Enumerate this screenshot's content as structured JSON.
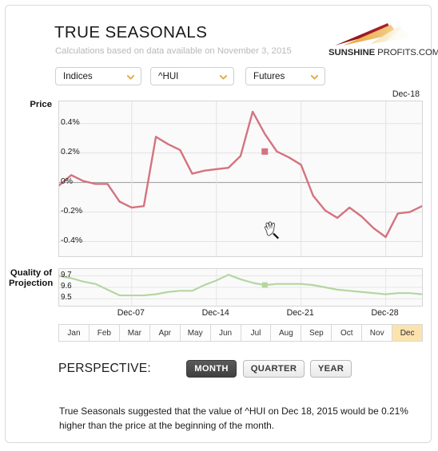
{
  "header": {
    "title": "TRUE SEASONALS",
    "subtitle": "Calculations based on data available on November 3, 2015",
    "logo_bold": "SUNSHINE ",
    "logo_light": "PROFITS.COM"
  },
  "selectors": [
    {
      "name": "indices",
      "value": "Indices"
    },
    {
      "name": "symbol",
      "value": "^HUI"
    },
    {
      "name": "market",
      "value": "Futures"
    }
  ],
  "price_chart": {
    "axis_title": "Price",
    "corner_label": "Dec-18",
    "y_ticks": [
      "0.4%",
      "0.2%",
      "0%",
      "-0.2%",
      "-0.4%"
    ]
  },
  "quality_chart": {
    "axis_title_line1": "Quality of",
    "axis_title_line2": "Projection",
    "y_ticks": [
      "9.7",
      "9.6",
      "9.5"
    ]
  },
  "x_axis": {
    "ticks": [
      "Dec-07",
      "Dec-14",
      "Dec-21",
      "Dec-28"
    ]
  },
  "months": {
    "items": [
      "Jan",
      "Feb",
      "Mar",
      "Apr",
      "May",
      "Jun",
      "Jul",
      "Aug",
      "Sep",
      "Oct",
      "Nov",
      "Dec"
    ],
    "selected": "Dec"
  },
  "perspective": {
    "label": "PERSPECTIVE:",
    "options": [
      "MONTH",
      "QUARTER",
      "YEAR"
    ],
    "selected": "MONTH"
  },
  "description": "True Seasonals suggested that the value of ^HUI on Dec 18, 2015 would be 0.21% higher than the price at the beginning of the month.",
  "colors": {
    "price_line": "#d4737f",
    "quality_line": "#b5d6a0",
    "month_active": "#fce3ae",
    "persp_active": "#4a4a4a",
    "panel_border": "#dadada",
    "plot_bg": "#fafafa"
  },
  "chart_data": [
    {
      "type": "line",
      "name": "price",
      "title": "Price",
      "ylabel": "Price",
      "xlabel": "",
      "ylim": [
        -0.5,
        0.55
      ],
      "yticks": [
        0.4,
        0.2,
        0.0,
        -0.2,
        -0.4
      ],
      "ytick_labels": [
        "0.4%",
        "0.2%",
        "0%",
        "-0.2%",
        "-0.4%"
      ],
      "xlim": [
        1,
        31
      ],
      "xticks": [
        7,
        14,
        21,
        28
      ],
      "xtick_labels": [
        "Dec-07",
        "Dec-14",
        "Dec-21",
        "Dec-28"
      ],
      "grid": true,
      "x": [
        1,
        2,
        3,
        4,
        5,
        6,
        7,
        8,
        9,
        10,
        11,
        12,
        13,
        14,
        15,
        16,
        17,
        18,
        19,
        20,
        21,
        22,
        23,
        24,
        25,
        26,
        27,
        28,
        29,
        30,
        31
      ],
      "values": [
        -0.02,
        0.05,
        0.01,
        -0.01,
        -0.01,
        -0.13,
        -0.17,
        -0.16,
        0.31,
        0.26,
        0.22,
        0.06,
        0.08,
        0.09,
        0.1,
        0.18,
        0.48,
        0.33,
        0.21,
        0.17,
        0.12,
        -0.09,
        -0.19,
        -0.24,
        -0.17,
        -0.23,
        -0.31,
        -0.37,
        -0.21,
        -0.2,
        -0.16
      ],
      "highlight_point": {
        "x": 18,
        "y": 0.21,
        "label": "Dec-18"
      }
    },
    {
      "type": "line",
      "name": "quality_of_projection",
      "title": "Quality of Projection",
      "ylabel": "Quality of Projection",
      "xlabel": "",
      "ylim": [
        9.44,
        9.76
      ],
      "yticks": [
        9.7,
        9.6,
        9.5
      ],
      "ytick_labels": [
        "9.7",
        "9.6",
        "9.5"
      ],
      "xlim": [
        1,
        31
      ],
      "xticks": [
        7,
        14,
        21,
        28
      ],
      "xtick_labels": [
        "Dec-07",
        "Dec-14",
        "Dec-21",
        "Dec-28"
      ],
      "grid": true,
      "x": [
        1,
        2,
        3,
        4,
        5,
        6,
        7,
        8,
        9,
        10,
        11,
        12,
        13,
        14,
        15,
        16,
        17,
        18,
        19,
        20,
        21,
        22,
        23,
        24,
        25,
        26,
        27,
        28,
        29,
        30,
        31
      ],
      "values": [
        9.7,
        9.68,
        9.65,
        9.63,
        9.58,
        9.53,
        9.53,
        9.53,
        9.54,
        9.56,
        9.57,
        9.57,
        9.62,
        9.66,
        9.71,
        9.67,
        9.64,
        9.62,
        9.63,
        9.63,
        9.63,
        9.62,
        9.6,
        9.58,
        9.57,
        9.56,
        9.55,
        9.54,
        9.55,
        9.55,
        9.54
      ],
      "highlight_point": {
        "x": 18,
        "y": 9.62,
        "label": "Dec-18"
      }
    }
  ]
}
